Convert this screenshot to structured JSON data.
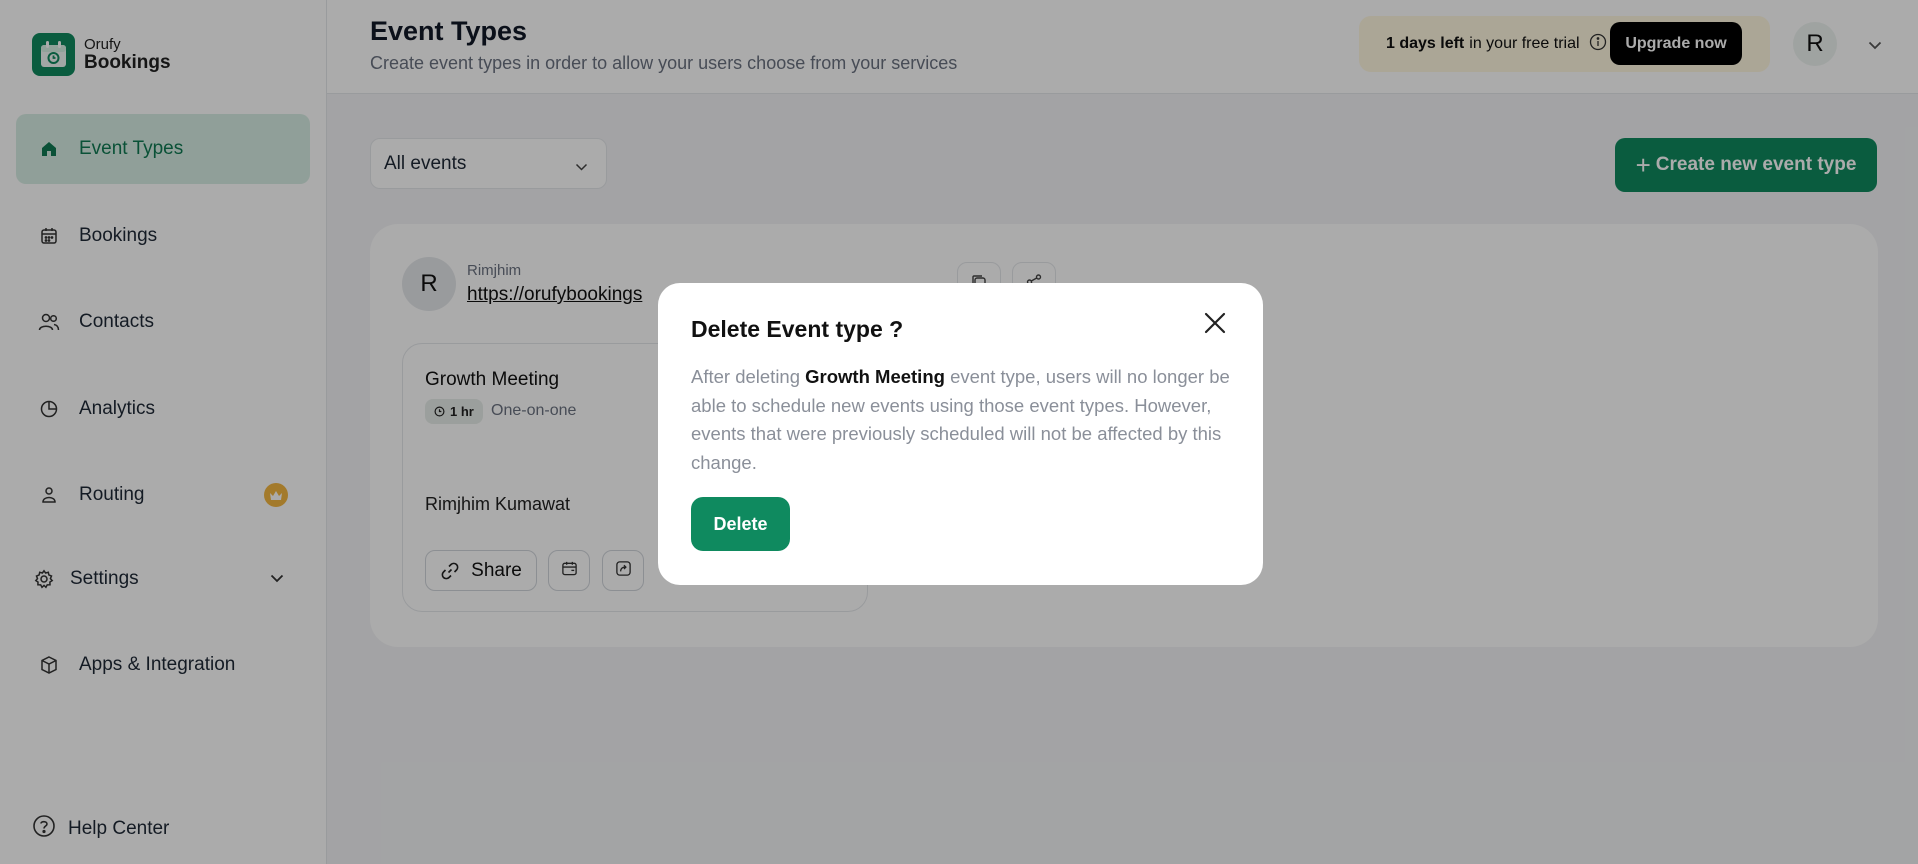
{
  "app": {
    "logo_top": "Orufy",
    "logo_bottom": "Bookings",
    "brand_color": "#0f8a5f"
  },
  "sidebar": {
    "items": [
      {
        "label": "Event Types",
        "icon": "home-icon",
        "active": true
      },
      {
        "label": "Bookings",
        "icon": "calendar-icon"
      },
      {
        "label": "Contacts",
        "icon": "users-icon"
      },
      {
        "label": "Analytics",
        "icon": "pie-chart-icon"
      },
      {
        "label": "Routing",
        "icon": "routing-icon",
        "badge_icon": "crown-icon"
      },
      {
        "label": "Settings",
        "icon": "gear-icon",
        "expandable": true
      },
      {
        "label": "Apps & Integration",
        "icon": "box-icon"
      }
    ],
    "help_label": "Help Center"
  },
  "header": {
    "title": "Event Types",
    "subtitle": "Create event types in order to allow your users choose from your services",
    "trial_days": "1 days left",
    "trial_rest": "in your free trial",
    "upgrade_label": "Upgrade now",
    "avatar_initial": "R"
  },
  "main": {
    "filter_value": "All events",
    "create_label": "Create new event type",
    "owner": {
      "initial": "R",
      "name": "Rimjhim",
      "link": "https://orufybookings"
    },
    "card": {
      "title": "Growth Meeting",
      "duration": "1 hr",
      "kind": "One-on-one",
      "host": "Rimjhim Kumawat",
      "share_label": "Share"
    }
  },
  "modal": {
    "title": "Delete Event type ?",
    "body_prefix": "After deleting",
    "body_event": "Growth Meeting",
    "body_suffix": "event type, users will no longer be able to schedule new events using those event types. However, events that were previously scheduled will not be affected by this change.",
    "delete_label": "Delete"
  }
}
